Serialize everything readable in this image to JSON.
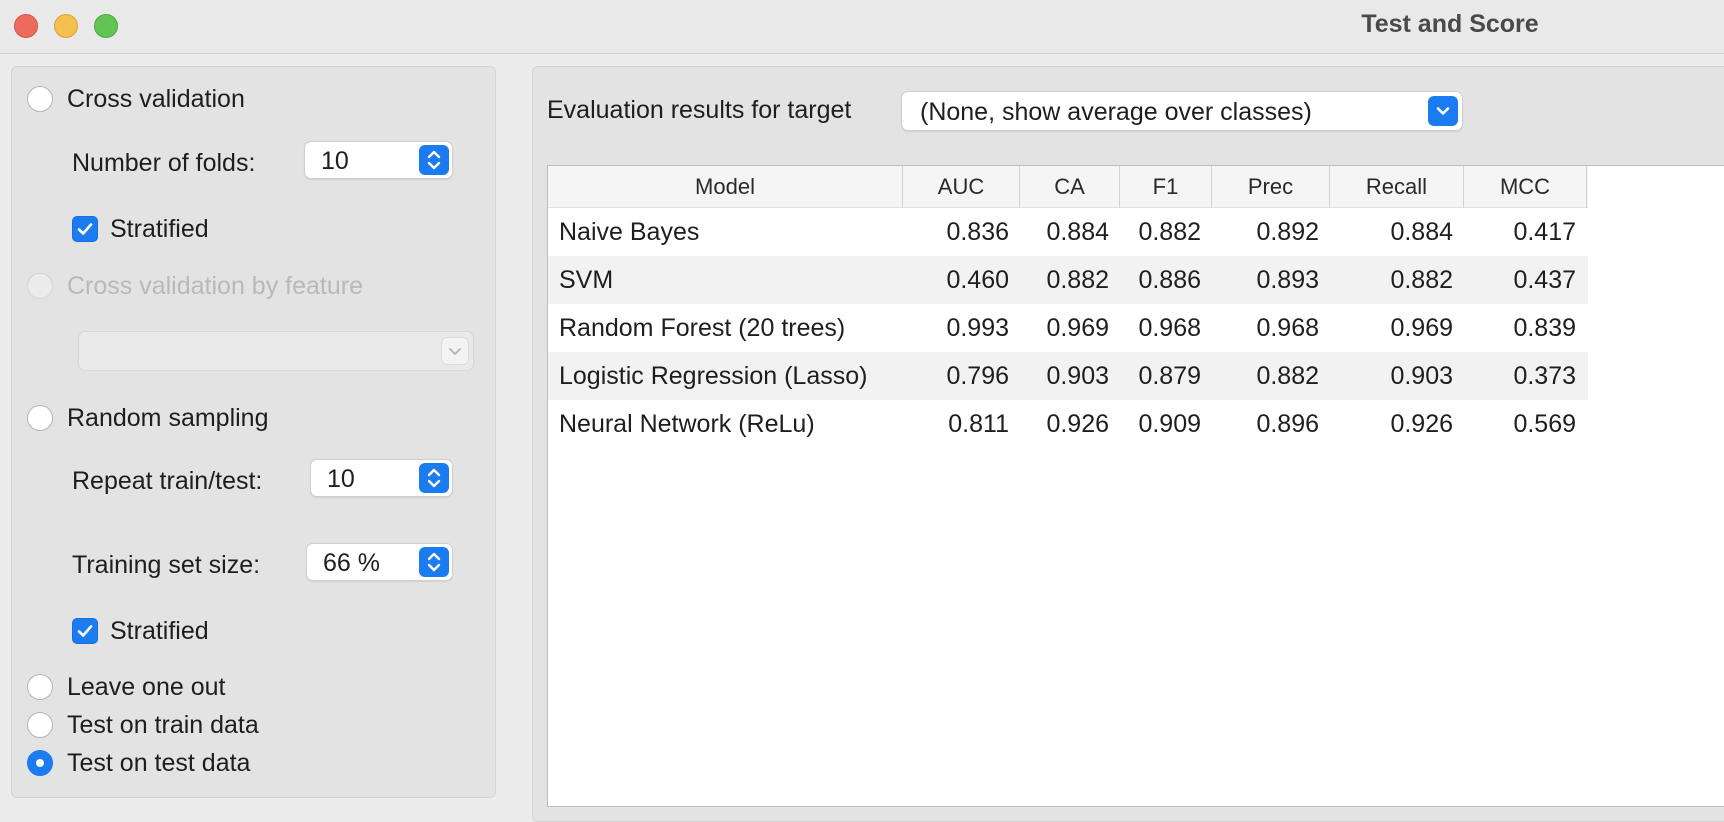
{
  "window": {
    "title": "Test and Score",
    "controls": [
      "close",
      "minimize",
      "maximize"
    ]
  },
  "sampling": {
    "cross_validation": {
      "label": "Cross validation",
      "selected": false,
      "folds_label": "Number of folds:",
      "folds_value": "10",
      "stratified_label": "Stratified",
      "stratified_checked": true
    },
    "cv_by_feature": {
      "label": "Cross validation by feature",
      "enabled": false,
      "selected_value": ""
    },
    "random_sampling": {
      "label": "Random sampling",
      "selected": false,
      "repeat_label": "Repeat train/test:",
      "repeat_value": "10",
      "train_size_label": "Training set size:",
      "train_size_value": "66 %",
      "stratified_label": "Stratified",
      "stratified_checked": true
    },
    "leave_one_out": {
      "label": "Leave one out",
      "selected": false
    },
    "test_on_train": {
      "label": "Test on train data",
      "selected": false
    },
    "test_on_test": {
      "label": "Test on test data",
      "selected": true
    }
  },
  "evaluation": {
    "target_label": "Evaluation results for target",
    "target_value": "(None, show average over classes)"
  },
  "table": {
    "columns": [
      "Model",
      "AUC",
      "CA",
      "F1",
      "Prec",
      "Recall",
      "MCC"
    ],
    "rows": [
      [
        "Naive Bayes",
        "0.836",
        "0.884",
        "0.882",
        "0.892",
        "0.884",
        "0.417"
      ],
      [
        "SVM",
        "0.460",
        "0.882",
        "0.886",
        "0.893",
        "0.882",
        "0.437"
      ],
      [
        "Random Forest (20 trees)",
        "0.993",
        "0.969",
        "0.968",
        "0.968",
        "0.969",
        "0.839"
      ],
      [
        "Logistic Regression (Lasso)",
        "0.796",
        "0.903",
        "0.879",
        "0.882",
        "0.903",
        "0.373"
      ],
      [
        "Neural Network (ReLu)",
        "0.811",
        "0.926",
        "0.909",
        "0.896",
        "0.926",
        "0.569"
      ]
    ]
  },
  "colors": {
    "accent": "#1b7cf2",
    "close": "#ed6a5e",
    "minimize": "#f5bf4f",
    "maximize": "#61c454"
  },
  "icons": {
    "checkmark": "check-icon",
    "spinner": "up-down-chevron-icon",
    "dropdown": "chevron-down-icon"
  }
}
